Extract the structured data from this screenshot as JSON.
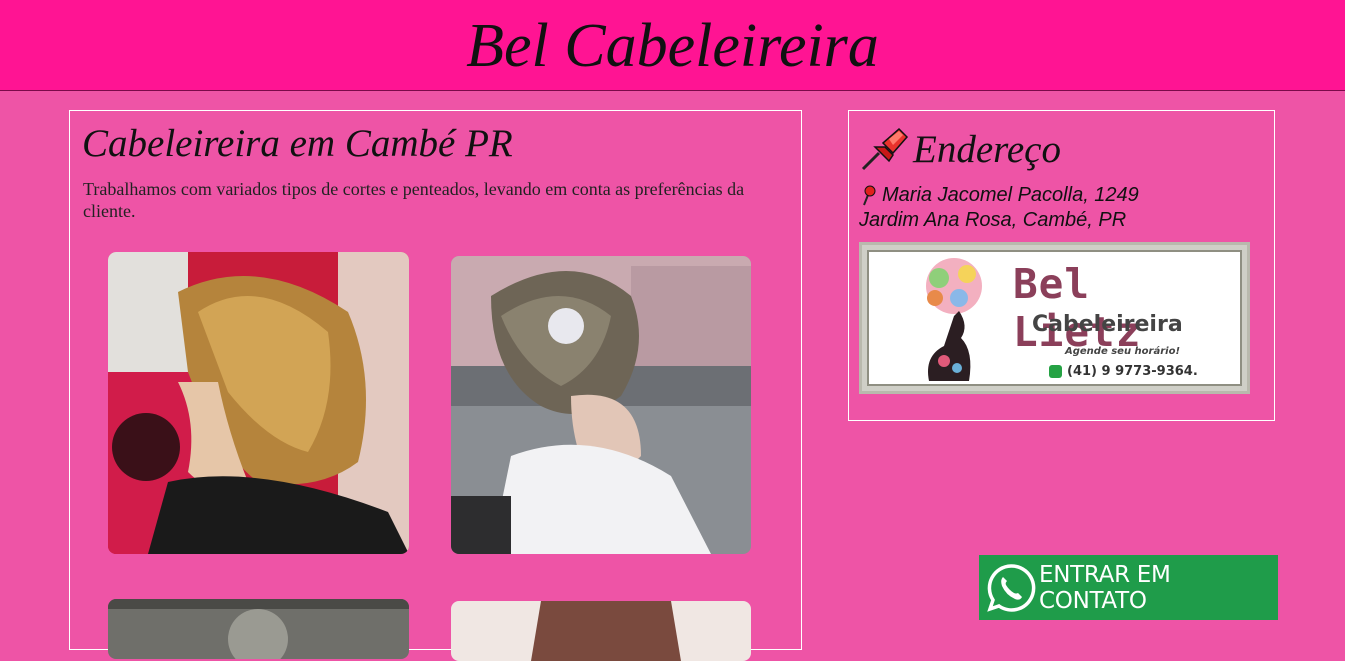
{
  "header": {
    "title": "Bel Cabeleireira"
  },
  "main": {
    "heading": "Cabeleireira em Cambé PR",
    "description": "Trabalhamos com variados tipos de cortes e penteados, levando em conta as preferências da cliente."
  },
  "sidebar": {
    "heading": "Endereço",
    "address_line1": "Maria Jacomel Pacolla, 1249",
    "address_line2": "Jardim Ana Rosa, Cambé, PR",
    "logo": {
      "name": "Bel Lietz",
      "subtitle": "Cabeleireira",
      "cta": "Agende seu  horário!",
      "phone": "(41) 9 9773-9364."
    }
  },
  "contact": {
    "label": "ENTRAR EM CONTATO"
  },
  "colors": {
    "header_bg": "#ff1493",
    "page_bg": "#ee54a6",
    "contact_button": "#1f9c4a"
  }
}
